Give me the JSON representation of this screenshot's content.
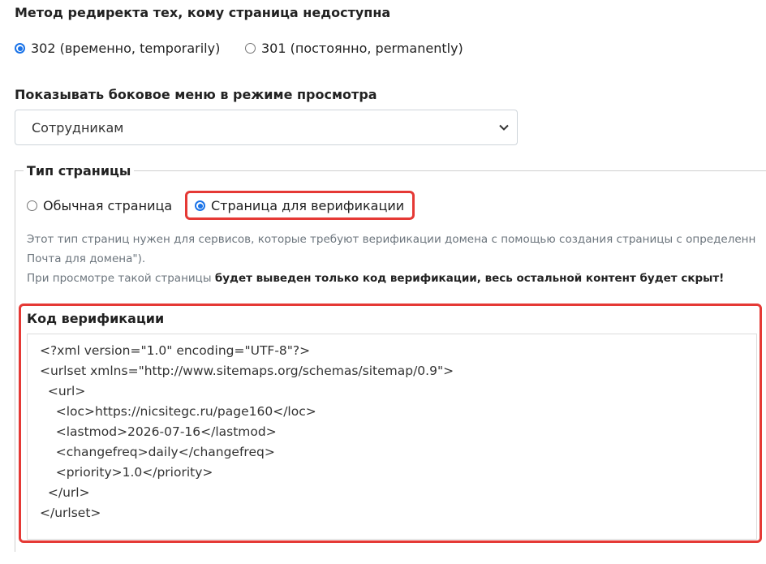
{
  "redirect": {
    "label": "Метод редиректа тех, кому страница недоступна",
    "options": [
      {
        "label": "302 (временно, temporarily)",
        "checked": true
      },
      {
        "label": "301 (постоянно, permanently)",
        "checked": false
      }
    ]
  },
  "sidebar_menu": {
    "label": "Показывать боковое меню в режиме просмотра",
    "selected": "Сотрудникам"
  },
  "page_type": {
    "legend": "Тип страницы",
    "options": [
      {
        "label": "Обычная страница",
        "checked": false
      },
      {
        "label": "Страница для верификации",
        "checked": true
      }
    ],
    "help_line1": "Этот тип страниц нужен для сервисов, которые требуют верификации домена с помощью создания страницы с определенн",
    "help_line2": "Почта для домена\").",
    "help_line3_prefix": "При просмотре такой страницы ",
    "help_line3_bold": "будет выведен только код верификации, весь остальной контент будет скрыт!"
  },
  "verification": {
    "label": "Код верификации",
    "code_lines": [
      "<?xml version=\"1.0\" encoding=\"UTF-8\"?>",
      "<urlset xmlns=\"http://www.sitemaps.org/schemas/sitemap/0.9\">",
      "  <url>",
      "    <loc>https://nicsitegc.ru/page160</loc>",
      "    <lastmod>2026-07-16</lastmod>",
      "    <changefreq>daily</changefreq>",
      "    <priority>1.0</priority>",
      "  </url>",
      "</urlset>"
    ]
  },
  "colors": {
    "highlight": "#e53935",
    "radio_accent": "#1a73e8"
  }
}
